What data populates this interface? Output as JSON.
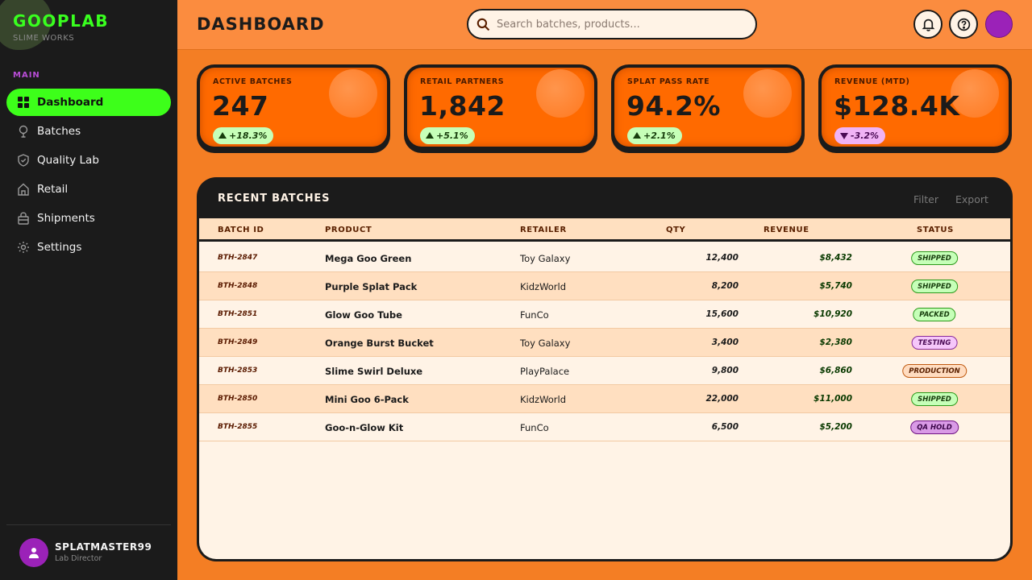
{
  "app": {
    "logo": "GOOPLAB",
    "tagline": "SLIME WORKS"
  },
  "sidebar": {
    "section_label": "Main",
    "items": [
      {
        "label": "Dashboard",
        "icon": "grid-icon",
        "active": true
      },
      {
        "label": "Batches",
        "icon": "flask-icon",
        "active": false
      },
      {
        "label": "Quality Lab",
        "icon": "shield-check-icon",
        "active": false
      },
      {
        "label": "Retail",
        "icon": "store-icon",
        "active": false
      },
      {
        "label": "Shipments",
        "icon": "package-icon",
        "active": false
      },
      {
        "label": "Settings",
        "icon": "gear-icon",
        "active": false
      }
    ],
    "profile": {
      "name": "SPLATMASTER99",
      "role": "Lab Director"
    }
  },
  "header": {
    "title": "DASHBOARD",
    "search_placeholder": "Search batches, products...",
    "search_value": ""
  },
  "stats": [
    {
      "label": "Active Batches",
      "value": "247",
      "delta": "+18.3%",
      "trend": "up"
    },
    {
      "label": "Retail Partners",
      "value": "1,842",
      "delta": "+5.1%",
      "trend": "up"
    },
    {
      "label": "Splat Pass Rate",
      "value": "94.2%",
      "delta": "+2.1%",
      "trend": "up"
    },
    {
      "label": "Revenue (MTD)",
      "value": "$128.4K",
      "delta": "-3.2%",
      "trend": "down"
    }
  ],
  "table": {
    "title": "Recent Batches",
    "actions": [
      "Filter",
      "Export"
    ],
    "columns": [
      "Batch ID",
      "Product",
      "Retailer",
      "Qty",
      "Revenue",
      "Status"
    ],
    "rows": [
      {
        "id": "BTH-2847",
        "product": "Mega Goo Green",
        "retailer": "Toy Galaxy",
        "qty": "12,400",
        "revenue": "$8,432",
        "status": "Shipped",
        "status_class": "b-shipped"
      },
      {
        "id": "BTH-2848",
        "product": "Purple Splat Pack",
        "retailer": "KidzWorld",
        "qty": "8,200",
        "revenue": "$5,740",
        "status": "Shipped",
        "status_class": "b-shipped"
      },
      {
        "id": "BTH-2851",
        "product": "Glow Goo Tube",
        "retailer": "FunCo",
        "qty": "15,600",
        "revenue": "$10,920",
        "status": "Packed",
        "status_class": "b-packed"
      },
      {
        "id": "BTH-2849",
        "product": "Orange Burst Bucket",
        "retailer": "Toy Galaxy",
        "qty": "3,400",
        "revenue": "$2,380",
        "status": "Testing",
        "status_class": "b-testing"
      },
      {
        "id": "BTH-2853",
        "product": "Slime Swirl Deluxe",
        "retailer": "PlayPalace",
        "qty": "9,800",
        "revenue": "$6,860",
        "status": "Production",
        "status_class": "b-production"
      },
      {
        "id": "BTH-2850",
        "product": "Mini Goo 6-Pack",
        "retailer": "KidzWorld",
        "qty": "22,000",
        "revenue": "$11,000",
        "status": "Shipped",
        "status_class": "b-shipped"
      },
      {
        "id": "BTH-2855",
        "product": "Goo-n-Glow Kit",
        "retailer": "FunCo",
        "qty": "6,500",
        "revenue": "$5,200",
        "status": "QA Hold",
        "status_class": "b-qahold"
      }
    ]
  },
  "colors": {
    "background": "#f47e24",
    "sidebar": "#1b1b1b",
    "accent_green": "#39ff1f",
    "accent_purple": "#9b22b8",
    "card": "#ff6a00"
  }
}
